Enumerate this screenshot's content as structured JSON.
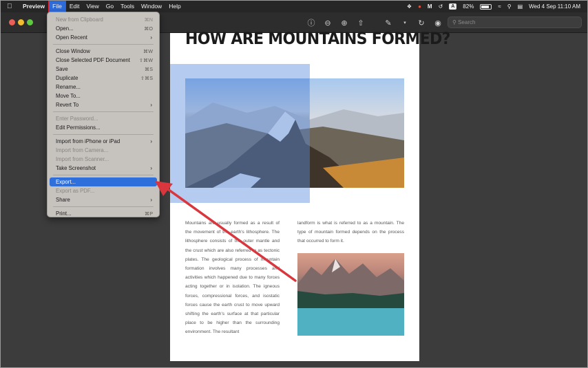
{
  "menubar": {
    "apple": "",
    "items": [
      "Preview",
      "File",
      "Edit",
      "View",
      "Go",
      "Tools",
      "Window",
      "Help"
    ],
    "status": {
      "battery": "82%",
      "keyboard": "A",
      "datetime": "Wed 4 Sep  11:10 AM"
    }
  },
  "toolbar": {
    "search_placeholder": "Search",
    "traffic_lights": [
      "#ec5f57",
      "#f3be2e",
      "#5fc93f"
    ]
  },
  "file_menu": {
    "groups": [
      [
        {
          "label": "New from Clipboard",
          "shortcut": "⌘N",
          "disabled": true
        },
        {
          "label": "Open...",
          "shortcut": "⌘O"
        },
        {
          "label": "Open Recent",
          "submenu": true
        }
      ],
      [
        {
          "label": "Close Window",
          "shortcut": "⌘W"
        },
        {
          "label": "Close Selected PDF Document",
          "shortcut": "⇧⌘W"
        },
        {
          "label": "Save",
          "shortcut": "⌘S"
        },
        {
          "label": "Duplicate",
          "shortcut": "⇧⌘S"
        },
        {
          "label": "Rename..."
        },
        {
          "label": "Move To..."
        },
        {
          "label": "Revert To",
          "submenu": true
        }
      ],
      [
        {
          "label": "Enter Password...",
          "disabled": true
        },
        {
          "label": "Edit Permissions..."
        }
      ],
      [
        {
          "label": "Import from iPhone or iPad",
          "submenu": true
        },
        {
          "label": "Import from Camera...",
          "disabled": true
        },
        {
          "label": "Import from Scanner...",
          "disabled": true
        },
        {
          "label": "Take Screenshot",
          "submenu": true
        }
      ],
      [
        {
          "label": "Export...",
          "highlighted": true
        },
        {
          "label": "Export as PDF...",
          "disabled": true
        },
        {
          "label": "Share",
          "submenu": true
        }
      ],
      [
        {
          "label": "Print...",
          "shortcut": "⌘P"
        }
      ]
    ]
  },
  "document": {
    "title": "HOW ARE MOUNTAINS FORMED?",
    "col1": "Mountains are usually formed as a result of the movement of the earth's lithosphere. The lithosphere consists of the outer mantle and the crust which are also referred to as tectonic plates. The geological process of mountain formation involves many processes and activities which happened due to many forces acting together or in isolation. The igneous forces, compressional forces, and isostatic forces cause the earth crust to move upward shifting the earth's surface at that particular place to be higher than the surrounding environment. The resultant",
    "col2": "landform is what is referred to as a mountain. The type of mountain formed depends on the process that occurred to form it."
  },
  "colors": {
    "highlight": "#2e6fdb",
    "annotation_arrow": "#d9363e",
    "selection_overlay": "#5a8cdc"
  }
}
